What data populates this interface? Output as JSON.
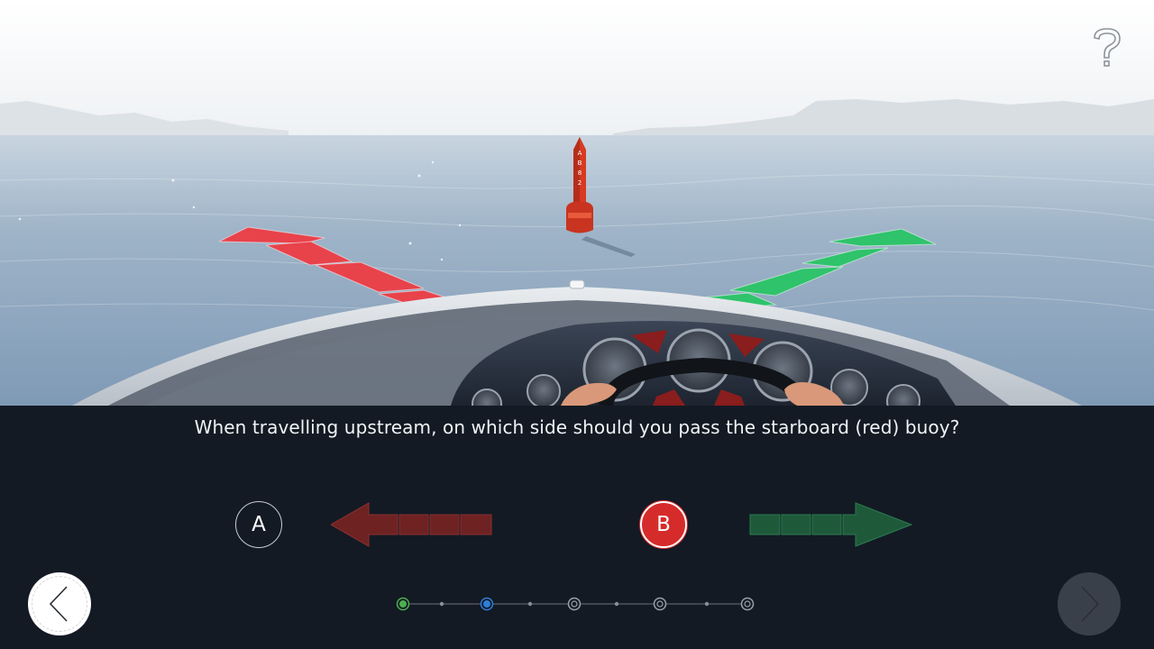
{
  "question": {
    "text": "When travelling upstream, on which side should you pass the starboard (red) buoy?"
  },
  "buoy": {
    "label_chars": [
      "A",
      "B",
      "8",
      "2"
    ]
  },
  "options": [
    {
      "label": "A",
      "direction": "left",
      "arrow_color": "#6e2222",
      "selected": false
    },
    {
      "label": "B",
      "direction": "right",
      "arrow_color": "#1e5a3a",
      "selected": true
    }
  ],
  "progress": {
    "steps": [
      {
        "state": "completed",
        "color": "#4caf50"
      },
      {
        "state": "current",
        "color": "#2f7ed8"
      },
      {
        "state": "upcoming",
        "color": "#9aa0a8"
      },
      {
        "state": "upcoming",
        "color": "#9aa0a8"
      },
      {
        "state": "upcoming",
        "color": "#9aa0a8"
      }
    ]
  },
  "icons": {
    "help": "question-mark-icon",
    "prev": "chevron-left-icon",
    "next": "chevron-right-icon"
  },
  "colors": {
    "panel_bg": "#131a24",
    "red_arrow": "#e8424b",
    "green_arrow": "#2fc36b",
    "buoy_red": "#d83a22"
  }
}
